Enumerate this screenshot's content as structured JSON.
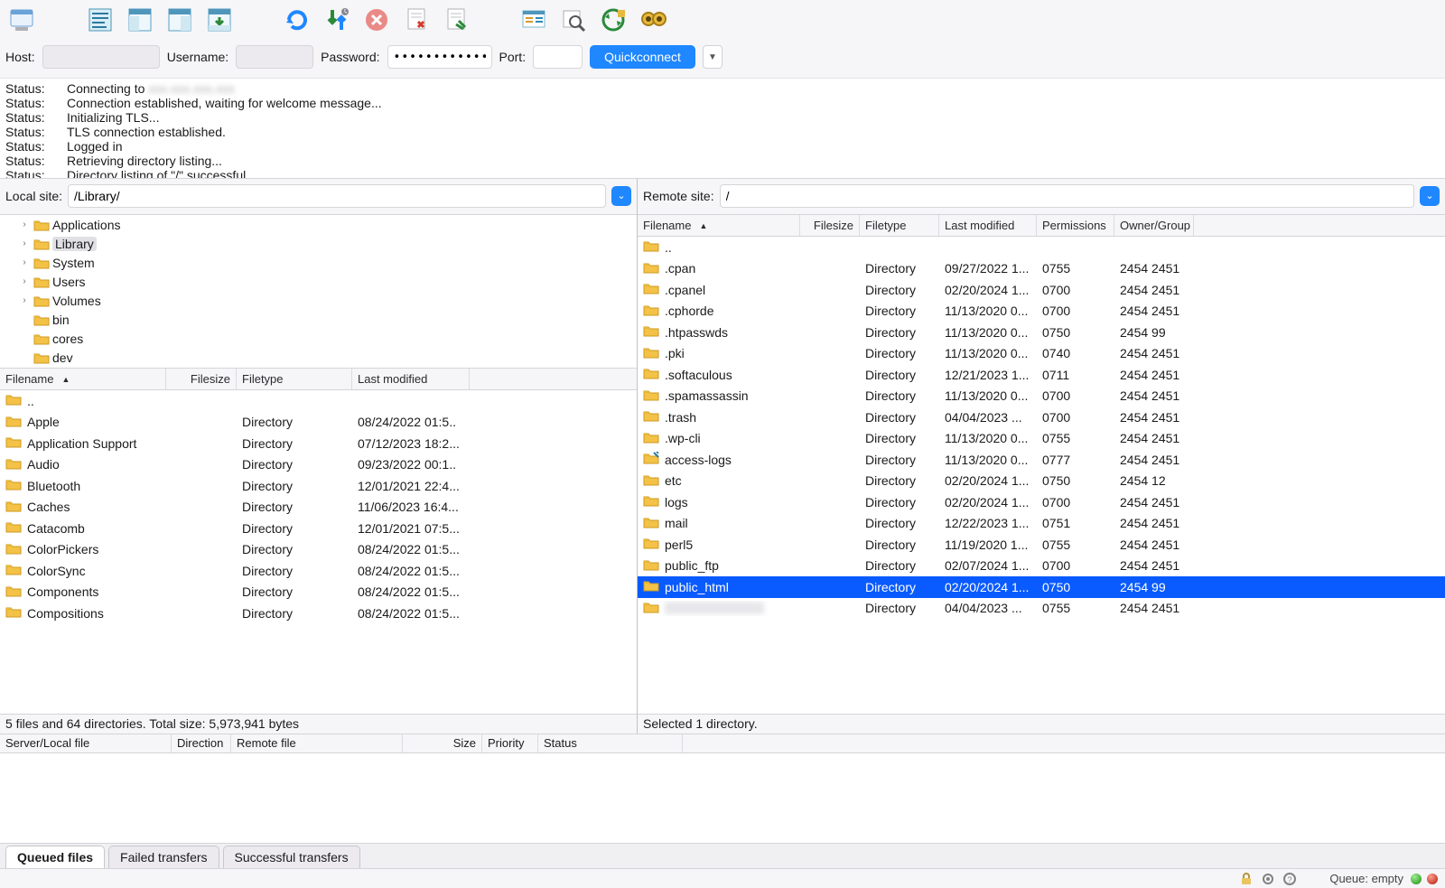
{
  "toolbar_icons": [
    "site-manager-icon",
    "gap-lg",
    "toggle-log-icon",
    "toggle-local-tree-icon",
    "toggle-remote-tree-icon",
    "toggle-queue-icon",
    "gap-lg",
    "refresh-icon",
    "process-queue-icon",
    "cancel-icon",
    "disconnect-icon",
    "reconnect-icon",
    "gap-lg",
    "filter-icon",
    "search-icon",
    "sync-browsing-icon",
    "compare-icon"
  ],
  "quickconnect": {
    "host_label": "Host:",
    "host_value": "",
    "user_label": "Username:",
    "user_value": "",
    "pass_label": "Password:",
    "pass_value": "••••••••••••••",
    "port_label": "Port:",
    "port_value": "",
    "button": "Quickconnect"
  },
  "log": [
    {
      "label": "Status:",
      "text": "Connecting to ",
      "redacted": "xxx.xxx.xxx.xxx"
    },
    {
      "label": "Status:",
      "text": "Connection established, waiting for welcome message..."
    },
    {
      "label": "Status:",
      "text": "Initializing TLS..."
    },
    {
      "label": "Status:",
      "text": "TLS connection established."
    },
    {
      "label": "Status:",
      "text": "Logged in"
    },
    {
      "label": "Status:",
      "text": "Retrieving directory listing..."
    },
    {
      "label": "Status:",
      "text": "Directory listing of \"/\" successful"
    }
  ],
  "local": {
    "site_label": "Local site:",
    "path": "/Library/",
    "tree": [
      {
        "name": "Applications",
        "expandable": true,
        "depth": 1
      },
      {
        "name": "Library",
        "expandable": true,
        "depth": 1,
        "selected": true
      },
      {
        "name": "System",
        "expandable": true,
        "depth": 1
      },
      {
        "name": "Users",
        "expandable": true,
        "depth": 1
      },
      {
        "name": "Volumes",
        "expandable": true,
        "depth": 1
      },
      {
        "name": "bin",
        "expandable": false,
        "depth": 1
      },
      {
        "name": "cores",
        "expandable": false,
        "depth": 1
      },
      {
        "name": "dev",
        "expandable": false,
        "depth": 1
      }
    ],
    "columns": {
      "filename": "Filename",
      "filesize": "Filesize",
      "filetype": "Filetype",
      "modified": "Last modified"
    },
    "files": [
      {
        "name": "..",
        "type": "",
        "size": "",
        "mod": ""
      },
      {
        "name": "Apple",
        "type": "Directory",
        "size": "",
        "mod": "08/24/2022 01:5.."
      },
      {
        "name": "Application Support",
        "type": "Directory",
        "size": "",
        "mod": "07/12/2023 18:2..."
      },
      {
        "name": "Audio",
        "type": "Directory",
        "size": "",
        "mod": "09/23/2022 00:1.."
      },
      {
        "name": "Bluetooth",
        "type": "Directory",
        "size": "",
        "mod": "12/01/2021 22:4..."
      },
      {
        "name": "Caches",
        "type": "Directory",
        "size": "",
        "mod": "11/06/2023 16:4..."
      },
      {
        "name": "Catacomb",
        "type": "Directory",
        "size": "",
        "mod": "12/01/2021 07:5..."
      },
      {
        "name": "ColorPickers",
        "type": "Directory",
        "size": "",
        "mod": "08/24/2022 01:5..."
      },
      {
        "name": "ColorSync",
        "type": "Directory",
        "size": "",
        "mod": "08/24/2022 01:5..."
      },
      {
        "name": "Components",
        "type": "Directory",
        "size": "",
        "mod": "08/24/2022 01:5..."
      },
      {
        "name": "Compositions",
        "type": "Directory",
        "size": "",
        "mod": "08/24/2022 01:5..."
      }
    ],
    "status": "5 files and 64 directories. Total size: 5,973,941 bytes"
  },
  "remote": {
    "site_label": "Remote site:",
    "path": "/",
    "columns": {
      "filename": "Filename",
      "filesize": "Filesize",
      "filetype": "Filetype",
      "modified": "Last modified",
      "perm": "Permissions",
      "owner": "Owner/Group"
    },
    "files": [
      {
        "name": "..",
        "type": "",
        "size": "",
        "mod": "",
        "perm": "",
        "own": ""
      },
      {
        "name": ".cpan",
        "type": "Directory",
        "size": "",
        "mod": "09/27/2022 1...",
        "perm": "0755",
        "own": "2454 2451"
      },
      {
        "name": ".cpanel",
        "type": "Directory",
        "size": "",
        "mod": "02/20/2024 1...",
        "perm": "0700",
        "own": "2454 2451"
      },
      {
        "name": ".cphorde",
        "type": "Directory",
        "size": "",
        "mod": "11/13/2020 0...",
        "perm": "0700",
        "own": "2454 2451"
      },
      {
        "name": ".htpasswds",
        "type": "Directory",
        "size": "",
        "mod": "11/13/2020 0...",
        "perm": "0750",
        "own": "2454 99"
      },
      {
        "name": ".pki",
        "type": "Directory",
        "size": "",
        "mod": "11/13/2020 0...",
        "perm": "0740",
        "own": "2454 2451"
      },
      {
        "name": ".softaculous",
        "type": "Directory",
        "size": "",
        "mod": "12/21/2023 1...",
        "perm": "0711",
        "own": "2454 2451"
      },
      {
        "name": ".spamassassin",
        "type": "Directory",
        "size": "",
        "mod": "11/13/2020 0...",
        "perm": "0700",
        "own": "2454 2451"
      },
      {
        "name": ".trash",
        "type": "Directory",
        "size": "",
        "mod": "04/04/2023 ...",
        "perm": "0700",
        "own": "2454 2451"
      },
      {
        "name": ".wp-cli",
        "type": "Directory",
        "size": "",
        "mod": "11/13/2020 0...",
        "perm": "0755",
        "own": "2454 2451"
      },
      {
        "name": "access-logs",
        "type": "Directory",
        "size": "",
        "mod": "11/13/2020 0...",
        "perm": "0777",
        "own": "2454 2451",
        "link": true
      },
      {
        "name": "etc",
        "type": "Directory",
        "size": "",
        "mod": "02/20/2024 1...",
        "perm": "0750",
        "own": "2454 12"
      },
      {
        "name": "logs",
        "type": "Directory",
        "size": "",
        "mod": "02/20/2024 1...",
        "perm": "0700",
        "own": "2454 2451"
      },
      {
        "name": "mail",
        "type": "Directory",
        "size": "",
        "mod": "12/22/2023 1...",
        "perm": "0751",
        "own": "2454 2451"
      },
      {
        "name": "perl5",
        "type": "Directory",
        "size": "",
        "mod": "11/19/2020 1...",
        "perm": "0755",
        "own": "2454 2451"
      },
      {
        "name": "public_ftp",
        "type": "Directory",
        "size": "",
        "mod": "02/07/2024 1...",
        "perm": "0700",
        "own": "2454 2451"
      },
      {
        "name": "public_html",
        "type": "Directory",
        "size": "",
        "mod": "02/20/2024 1...",
        "perm": "0750",
        "own": "2454 99",
        "selected": true
      },
      {
        "name": "",
        "redacted": true,
        "type": "Directory",
        "size": "",
        "mod": "04/04/2023 ...",
        "perm": "0755",
        "own": "2454 2451"
      }
    ],
    "status": "Selected 1 directory."
  },
  "queue": {
    "columns": {
      "slf": "Server/Local file",
      "dir": "Direction",
      "rfile": "Remote file",
      "size": "Size",
      "pri": "Priority",
      "stat": "Status"
    }
  },
  "tabs": {
    "queued": "Queued files",
    "failed": "Failed transfers",
    "success": "Successful transfers"
  },
  "bottom": {
    "queue_label": "Queue: empty"
  }
}
